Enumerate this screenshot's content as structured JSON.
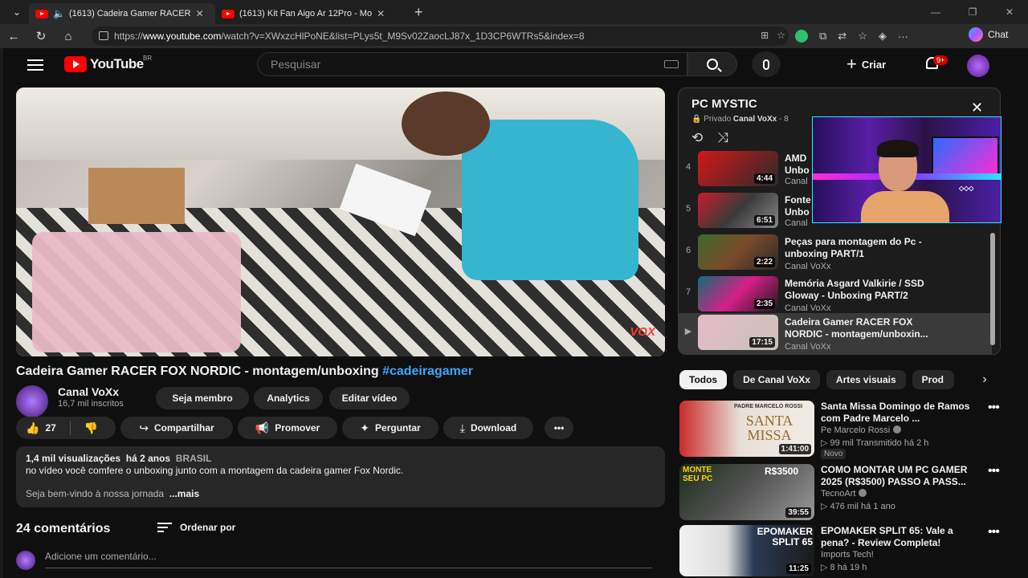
{
  "browser": {
    "tabs": [
      {
        "title": "(1613) Cadeira Gamer RACER"
      },
      {
        "title": "(1613) Kit Fan Aigo Ar 12Pro - Mo"
      }
    ],
    "url_prefix": "https://",
    "url_host": "www.youtube.com",
    "url_path": "/watch?v=XWxzcHlPoNE&list=PLys5t_M9Sv02ZaocLJ87x_1D3CP6WTRs5&index=8",
    "chat_label": "Chat"
  },
  "header": {
    "logo_text": "YouTube",
    "logo_region": "BR",
    "search_placeholder": "Pesquisar",
    "create_label": "Criar",
    "notif_badge": "9+"
  },
  "video": {
    "title": "Cadeira Gamer RACER FOX NORDIC - montagem/unboxing",
    "hashtag": "#cadeiragamer",
    "watermark": "VOX",
    "channel": "Canal VoXx",
    "subs": "16,7 mil inscritos",
    "buttons": {
      "member": "Seja membro",
      "analytics": "Analytics",
      "edit": "Editar vídeo"
    },
    "likes": "27",
    "actions": {
      "share": "Compartilhar",
      "promote": "Promover",
      "ask": "Perguntar",
      "download": "Download"
    },
    "views": "1,4 mil visualizações",
    "age": "há 2 anos",
    "country": "BRASIL",
    "desc_line1": "no vídeo você comfere o unboxing junto com a montagem da cadeira gamer Fox Nordic.",
    "desc_line2": "Seja bem-vindo à nossa jornada",
    "more": "...mais",
    "comments_count": "24 comentários",
    "sort_label": "Ordenar por",
    "comment_placeholder": "Adicione um comentário..."
  },
  "playlist": {
    "title": "PC MYSTIC",
    "privacy": "Privado",
    "owner": "Canal VoXx",
    "owner_suffix": "- 8",
    "items": [
      {
        "idx": "4",
        "title": "AMD",
        "title2": "Unbo",
        "duration": "4:44",
        "channel": "Canal"
      },
      {
        "idx": "5",
        "title": "Fonte",
        "title2": "Unbo",
        "duration": "6:51",
        "channel": "Canal"
      },
      {
        "idx": "6",
        "title": "Peças para montagem do Pc -",
        "title2": "unboxing PART/1",
        "duration": "2:22",
        "channel": "Canal VoXx"
      },
      {
        "idx": "7",
        "title": "Memória Asgard Valkirie / SSD",
        "title2": "Gloway - Unboxing PART/2",
        "duration": "2:35",
        "channel": "Canal VoXx"
      },
      {
        "idx": "▶",
        "title": "Cadeira Gamer RACER FOX",
        "title2": "NORDIC - montagem/unboxin...",
        "duration": "17:15",
        "channel": "Canal VoXx"
      }
    ]
  },
  "chips": [
    "Todos",
    "De Canal VoXx",
    "Artes visuais",
    "Prod"
  ],
  "recommendations": [
    {
      "title": "Santa Missa Domingo de Ramos com Padre Marcelo ...",
      "channel": "Pe Marcelo Rossi",
      "meta": "▷ 99 mil  Transmitido há 2 h",
      "duration": "1:41:00",
      "badge": "Novo",
      "thumb_text": "SANTA MISSA",
      "thumb_top": "PADRE MARCELO ROSSI"
    },
    {
      "title": "COMO MONTAR UM PC GAMER 2025 (R$3500) PASSO A PASS...",
      "channel": "TecnoArt",
      "meta": "▷ 476 mil  há 1 ano",
      "duration": "39:55",
      "thumb_text": "R$3500",
      "thumb_top": "MONTE SEU PC"
    },
    {
      "title": "EPOMAKER SPLIT 65: Vale a pena? - Review Completa!",
      "channel": "Imports Tech!",
      "meta": "▷ 8  há 19 h",
      "duration": "11:25",
      "thumb_text": "EPOMAKER SPLIT 65",
      "thumb_top": ""
    }
  ],
  "colors": {
    "youtube_red": "#ff0000",
    "accent_link": "#3ea6ff",
    "bg": "#0f0f0f",
    "chip_bg": "#272727"
  }
}
